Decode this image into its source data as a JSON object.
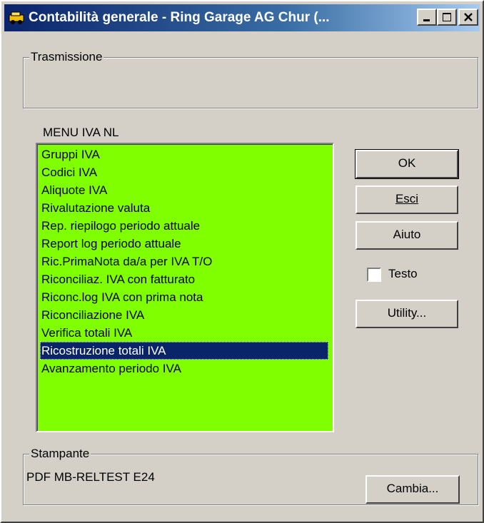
{
  "window": {
    "title": "Contabilità generale - Ring Garage AG Chur (...",
    "icon": "car-icon"
  },
  "transmission": {
    "label": "Trasmissione"
  },
  "menu": {
    "label": "MENU IVA NL",
    "items": [
      "Gruppi IVA",
      "Codici IVA",
      "Aliquote IVA",
      "Rivalutazione valuta",
      "Rep. riepilogo periodo attuale",
      "Report log periodo attuale",
      "Ric.PrimaNota da/a per IVA T/O",
      "Riconciliaz. IVA con fatturato",
      "Riconc.log IVA con prima nota",
      "Riconciliazione IVA",
      "Verifica totali IVA",
      "Ricostruzione totali IVA",
      "Avanzamento periodo IVA"
    ],
    "selected": "Ricostruzione totali IVA"
  },
  "buttons": {
    "ok": "OK",
    "exit": "Esci",
    "help": "Aiuto",
    "utility": "Utility...",
    "change": "Cambia..."
  },
  "text_checkbox": {
    "label": "Testo",
    "checked": false
  },
  "printer": {
    "label": "Stampante",
    "name": "PDF MB-RELTEST E24"
  },
  "colors": {
    "list_background": "#7fff00",
    "selection": "#0a246a",
    "titlebar": "#0a246a"
  }
}
